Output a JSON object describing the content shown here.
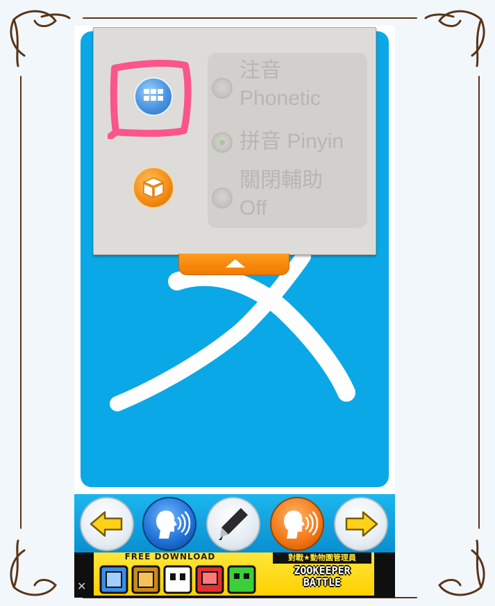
{
  "popup": {
    "options": [
      {
        "line1": "注音",
        "line2": "Phonetic",
        "selected": false
      },
      {
        "line1": "拼音 Pinyin",
        "line2": "",
        "selected": true
      },
      {
        "line1": "關閉輔助",
        "line2": "Off",
        "selected": false
      }
    ],
    "grid_icon": "grid-icon",
    "box_icon": "package-icon",
    "handle_icon": "chevron-up-icon"
  },
  "card": {
    "letter": "x"
  },
  "toolbar": {
    "buttons": [
      "prev-arrow-icon",
      "speak-icon",
      "pen-icon",
      "speak-icon",
      "next-arrow-icon"
    ]
  },
  "ad": {
    "free_download": "FREE DOWNLOAD",
    "subtitle": "對戰★動物園管理員",
    "title_line1": "ZOOKEEPER",
    "title_line2": "BATTLE",
    "close": "✕"
  },
  "colors": {
    "card_blue": "#0aa8e6",
    "accent_orange": "#f07b00",
    "highlight_pink": "#ff3d7f"
  }
}
